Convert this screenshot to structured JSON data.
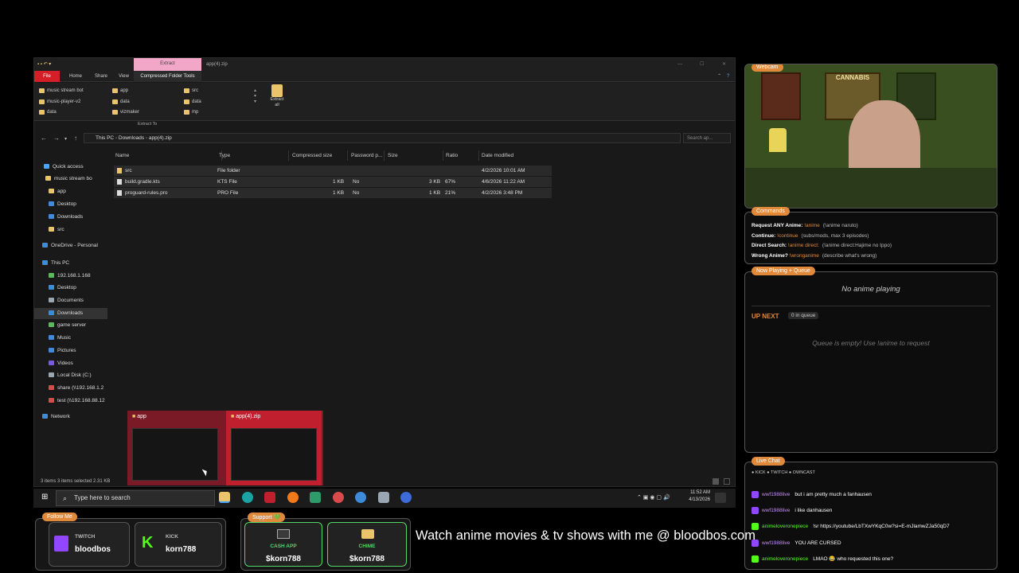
{
  "explorer": {
    "window_title": "app(4).zip",
    "extract_tab": "Extract",
    "ribbon_tabs": [
      "File",
      "Home",
      "Share",
      "View",
      "Compressed Folder Tools"
    ],
    "ribbon_folders_col1": [
      "music stream bot",
      "music-player-v2",
      "data"
    ],
    "ribbon_folders_col2": [
      "app",
      "data",
      "vizmaker"
    ],
    "ribbon_folders_col3": [
      "src",
      "data",
      "mp"
    ],
    "extract_to_label": "Extract To",
    "extract_all_label": "Extract all",
    "address_path": [
      "This PC",
      "Downloads",
      "app(4).zip"
    ],
    "search_placeholder": "Search ap...",
    "nav_items": [
      {
        "label": "Quick access",
        "color": "#4aa3ff"
      },
      {
        "label": "music stream bo",
        "color": "#e9c46a"
      },
      {
        "label": "app",
        "color": "#e9c46a"
      },
      {
        "label": "Desktop",
        "color": "#3d8bd9"
      },
      {
        "label": "Downloads",
        "color": "#3d8bd9"
      },
      {
        "label": "src",
        "color": "#e9c46a"
      },
      {
        "label": "OneDrive - Personal",
        "color": "#3d8bd9"
      },
      {
        "label": "This PC",
        "color": "#3d8bd9"
      },
      {
        "label": "192.168.1.168",
        "color": "#5bb85b"
      },
      {
        "label": "Desktop",
        "color": "#3d8bd9"
      },
      {
        "label": "Documents",
        "color": "#9aa6b2"
      },
      {
        "label": "Downloads",
        "color": "#3d8bd9"
      },
      {
        "label": "game server",
        "color": "#5bb85b"
      },
      {
        "label": "Music",
        "color": "#3d8bd9"
      },
      {
        "label": "Pictures",
        "color": "#3d8bd9"
      },
      {
        "label": "Videos",
        "color": "#7b5bd9"
      },
      {
        "label": "Local Disk (C:)",
        "color": "#9aa6b2"
      },
      {
        "label": "share (\\\\192.168.1.2",
        "color": "#d94a4a"
      },
      {
        "label": "test (\\\\192.168.88.12",
        "color": "#d94a4a"
      },
      {
        "label": "Network",
        "color": "#3d8bd9"
      }
    ],
    "columns": [
      "Name",
      "Type",
      "Compressed size",
      "Password p...",
      "Size",
      "Ratio",
      "Date modified"
    ],
    "files": [
      {
        "name": "src",
        "type": "File folder",
        "csize": "",
        "pw": "",
        "size": "",
        "ratio": "",
        "date": "4/2/2026 10:01 AM"
      },
      {
        "name": "build.gradle.kts",
        "type": "KTS File",
        "csize": "1 KB",
        "pw": "No",
        "size": "3 KB",
        "ratio": "67%",
        "date": "4/6/2026 11:22 AM"
      },
      {
        "name": "proguard-rules.pro",
        "type": "PRO File",
        "csize": "1 KB",
        "pw": "No",
        "size": "1 KB",
        "ratio": "21%",
        "date": "4/2/2026 3:48 PM"
      }
    ],
    "status": "3 items   3 items selected  2.31 KB"
  },
  "thumbnails": [
    {
      "label": "app"
    },
    {
      "label": "app(4).zip"
    }
  ],
  "taskbar": {
    "search_placeholder": "Type here to search",
    "time": "11:52 AM",
    "date": "4/13/2026"
  },
  "webcam": {
    "tag": "Webcam",
    "poster_text": "CANNABIS"
  },
  "commands": {
    "tag": "Commands",
    "rows": [
      {
        "label": "Request ANY Anime:",
        "cmd": "!anime",
        "desc": "(!anime naruto)"
      },
      {
        "label": "Continue:",
        "cmd": "!continue",
        "desc": "(subs/mods, max 3 episodes)"
      },
      {
        "label": "Direct Search:",
        "cmd": "!anime direct:",
        "desc": "(!anime direct:Hajime no Ippo)"
      },
      {
        "label": "Wrong Anime?",
        "cmd": "!wronganime",
        "desc": "(describe what's wrong)"
      }
    ]
  },
  "now_playing": {
    "tag": "Now Playing + Queue",
    "status": "No anime playing",
    "up_next": "UP NEXT",
    "queue_count": "0 in queue",
    "empty_msg": "Queue is empty! Use !anime to request"
  },
  "chat": {
    "tag": "Live Chat",
    "platforms": "● KICK  ● TWITCH  ● OWNCAST",
    "messages": [
      {
        "user": "wwf1988live",
        "text": "but i am pretty much a fanhausen",
        "platform": "twitch"
      },
      {
        "user": "wwf1988live",
        "text": "i like danhausen",
        "platform": "twitch"
      },
      {
        "user": "animeloveronepiece",
        "text": "!sr https://youtube/LbTXwYKqC0w?si=E-mJlamwZJa50qD7",
        "platform": "kick"
      },
      {
        "user": "wwf1988live",
        "text": "YOU ARE CURSED",
        "platform": "twitch"
      },
      {
        "user": "animeloveronepiece",
        "text": "LMAO 😂 who requested this one?",
        "platform": "kick"
      }
    ]
  },
  "follow": {
    "tag": "Follow Me",
    "twitch_label": "TWITCH",
    "twitch_user": "bloodbos",
    "kick_label": "KICK",
    "kick_user": "korn788"
  },
  "support": {
    "tag": "Support 💚",
    "cashapp_label": "CASH APP",
    "cashapp_user": "$korn788",
    "chime_label": "CHIME",
    "chime_user": "$korn788"
  },
  "marquee": "Watch anime movies & tv shows with me @ bloodbos.com",
  "colors": {
    "accent": "#e0893b",
    "file_tab": "#d41f26",
    "extract_tab": "#f3a7c8",
    "kick": "#53fc18",
    "twitch": "#9146ff"
  }
}
